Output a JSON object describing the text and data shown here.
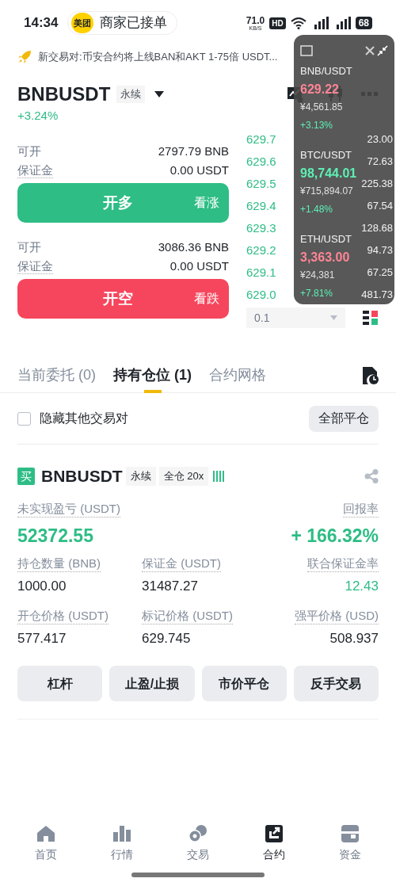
{
  "status_bar": {
    "time": "14:34",
    "notification": {
      "badge": "美团",
      "text": "商家已接单"
    },
    "net_speed": "71.0",
    "net_unit": "KB/S",
    "hd": "HD",
    "battery": "68"
  },
  "announcement": {
    "text": "新交易对:币安合约将上线BAN和AKT 1-75倍 USDT..."
  },
  "header": {
    "symbol": "BNBUSDT",
    "tag": "永续",
    "change": "+3.24%"
  },
  "orders": [
    {
      "kind": "long",
      "avail_label": "可开",
      "avail": "2797.79 BNB",
      "margin_label": "保证金",
      "margin": "0.00 USDT",
      "button": "开多",
      "hint": "看涨"
    },
    {
      "kind": "short",
      "avail_label": "可开",
      "avail": "3086.36 BNB",
      "margin_label": "保证金",
      "margin": "0.00 USDT",
      "button": "开空",
      "hint": "看跌"
    }
  ],
  "order_book": {
    "rows": [
      {
        "price": "629.7",
        "qty": "23.00"
      },
      {
        "price": "629.6",
        "qty": "72.63"
      },
      {
        "price": "629.5",
        "qty": "225.38"
      },
      {
        "price": "629.4",
        "qty": "67.54"
      },
      {
        "price": "629.3",
        "qty": "128.68"
      },
      {
        "price": "629.2",
        "qty": "94.73"
      },
      {
        "price": "629.1",
        "qty": "67.25"
      },
      {
        "price": "629.0",
        "qty": "481.73"
      }
    ],
    "depth": "0.1"
  },
  "floating_ticker": {
    "items": [
      {
        "pair": "BNB/USDT",
        "price": "629.22",
        "falling": true,
        "cny": "¥4,561.85",
        "change": "+3.13%"
      },
      {
        "pair": "BTC/USDT",
        "price": "98,744.01",
        "falling": false,
        "cny": "¥715,894.07",
        "change": "+1.48%"
      },
      {
        "pair": "ETH/USDT",
        "price": "3,363.00",
        "falling": true,
        "cny": "¥24,381",
        "change": "+7.81%"
      }
    ]
  },
  "tabs": [
    {
      "label": "当前委托 (0)",
      "selected": false
    },
    {
      "label": "持有仓位 (1)",
      "selected": true
    },
    {
      "label": "合约网格",
      "selected": false
    }
  ],
  "filter": {
    "label": "隐藏其他交易对",
    "checked": false
  },
  "close_all": "全部平仓",
  "position": {
    "side": "买",
    "symbol": "BNBUSDT",
    "tags": [
      "永续",
      "全仓 20x"
    ],
    "pnl_label": "未实现盈亏 (USDT)",
    "pnl": "52372.55",
    "roe_label": "回报率",
    "roe": "+ 166.32%",
    "fields": [
      {
        "label": "持仓数量 (BNB)",
        "value": "1000.00",
        "kind": "plain"
      },
      {
        "label": "保证金 (USDT)",
        "value": "31487.27",
        "kind": "plain"
      },
      {
        "label": "联合保证金率",
        "value": "12.43",
        "kind": "positive"
      },
      {
        "label": "开仓价格 (USDT)",
        "value": "577.417",
        "kind": "plain"
      },
      {
        "label": "标记价格 (USDT)",
        "value": "629.745",
        "kind": "plain"
      },
      {
        "label": "强平价格 (USD)",
        "value": "508.937",
        "kind": "plain"
      }
    ],
    "actions": [
      "杠杆",
      "止盈/止损",
      "市价平仓",
      "反手交易"
    ]
  },
  "nav": [
    {
      "label": "首页",
      "selected": false
    },
    {
      "label": "行情",
      "selected": false
    },
    {
      "label": "交易",
      "selected": false
    },
    {
      "label": "合约",
      "selected": true
    },
    {
      "label": "资金",
      "selected": false
    }
  ]
}
